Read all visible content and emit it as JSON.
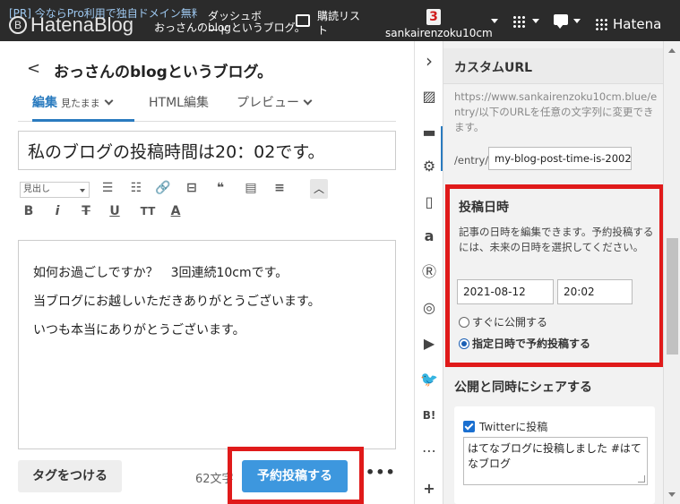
{
  "topbar": {
    "pr_text": "[PR] 今ならPro利用で独自ドメイン無料",
    "logo_text": "HatenaBlog",
    "blog_name": "おっさんのblogというブログ。",
    "dashboard_label": "ダッシュボード",
    "subscriptions_label": "購読リスト",
    "notification_count": "3",
    "username": "sankairenzoku10cm",
    "hatena_label": "Hatena"
  },
  "editor": {
    "back_label": "<",
    "blog_title": "おっさんのblogというブログ。",
    "tabs": [
      {
        "label": "編集",
        "sub": "見たまま"
      },
      {
        "label": "HTML編集"
      },
      {
        "label": "プレビュー"
      }
    ],
    "title_value": "私のブログの投稿時間は20：02です。",
    "format_select": "見出し",
    "body_lines": [
      "如何お過ごしですか？　3回連続10cmです。",
      "当ブログにお越しいただきありがとうございます。",
      "いつも本当にありがとうございます。"
    ],
    "tag_button": "タグをつける",
    "char_count": "62文字",
    "schedule_button": "予約投稿する",
    "more_button": "•••"
  },
  "toolbar": {
    "buttons": [
      "B",
      "i",
      "T",
      "U",
      "TT",
      "A"
    ]
  },
  "panel": {
    "custom_url_title": "カスタムURL",
    "custom_url_desc": "https://www.sankairenzoku10cm.blue/entry/以下のURLを任意の文字列に変更できます。",
    "entry_prefix": "/entry/",
    "slug_value": "my-blog-post-time-is-2002",
    "date_title": "投稿日時",
    "date_desc": "記事の日時を編集できます。予約投稿するには、未来の日時を選択してください。",
    "date_value": "2021-08-12",
    "time_value": "20:02",
    "radio_now": "すぐに公開する",
    "radio_scheduled": "指定日時で予約投稿する",
    "share_title": "公開と同時にシェアする",
    "twitter_label": "Twitterに投稿",
    "twitter_text": "はてなブログに投稿しました #はてなブログ"
  }
}
